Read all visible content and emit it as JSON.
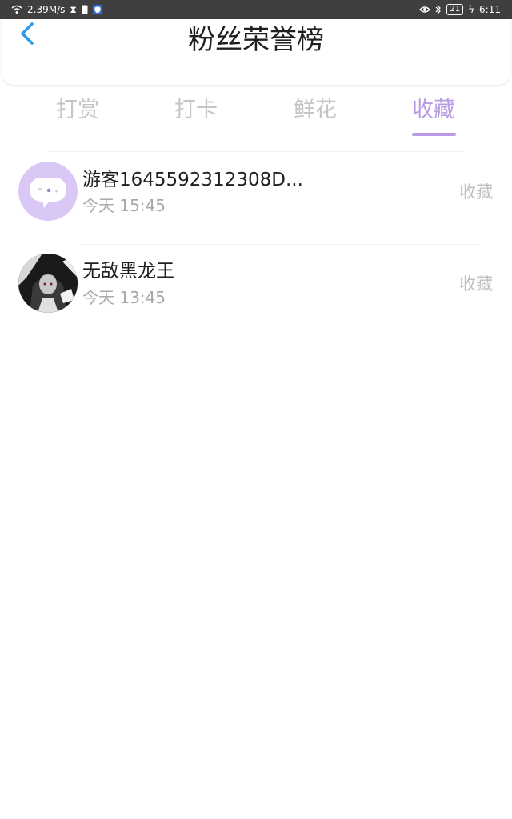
{
  "status_bar": {
    "speed": "2.39M/s",
    "battery": "21",
    "time": "6:11"
  },
  "header": {
    "title": "粉丝荣誉榜"
  },
  "tabs": [
    {
      "label": "打赏"
    },
    {
      "label": "打卡"
    },
    {
      "label": "鲜花"
    },
    {
      "label": "收藏"
    }
  ],
  "active_tab": "收藏",
  "colors": {
    "accent": "#b89be4",
    "back_arrow": "#2b9be8"
  },
  "list": [
    {
      "name": "游客1645592312308D...",
      "time": "今天 15:45",
      "action": "收藏",
      "avatar": "chat-bubble-avatar"
    },
    {
      "name": "无敌黑龙王",
      "time": "今天 13:45",
      "action": "收藏",
      "avatar": "user-photo-avatar"
    }
  ]
}
